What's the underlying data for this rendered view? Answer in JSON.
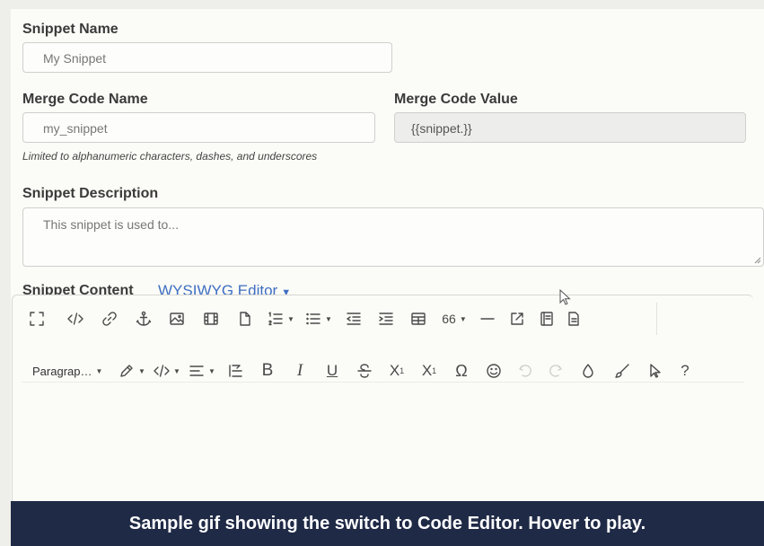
{
  "form": {
    "snippet_name_label": "Snippet Name",
    "snippet_name_value": "My Snippet",
    "merge_code_name_label": "Merge Code Name",
    "merge_code_name_value": "my_snippet",
    "merge_code_value_label": "Merge Code Value",
    "merge_code_value_value": "{{snippet.}}",
    "merge_code_hint": "Limited to alphanumeric characters, dashes, and underscores",
    "description_label": "Snippet Description",
    "description_placeholder": "This snippet is used to...",
    "content_label": "Snippet Content",
    "editor_toggle_label": "WYSIWYG Editor"
  },
  "toolbar": {
    "row1": [
      "fullscreen-icon",
      "code-view-icon",
      "link-icon",
      "anchor-icon",
      "image-icon",
      "video-icon",
      "file-icon",
      "ordered-list-icon",
      "unordered-list-icon",
      "outdent-icon",
      "indent-icon",
      "table-icon",
      "quote-icon",
      "horizontal-rule-icon",
      "external-link-icon",
      "template-icon",
      "document-icon"
    ],
    "quote_label": "66",
    "paragraph_label": "Paragrap…",
    "bold": "B",
    "italic": "I",
    "underline": "U",
    "subscript": "X",
    "subscript_sub": "1",
    "superscript": "X",
    "superscript_sup": "1",
    "omega": "Ω",
    "help": "?"
  },
  "banner": {
    "text": "Sample gif showing the switch to Code Editor. Hover to play."
  },
  "colors": {
    "accent": "#3f6fc2",
    "banner_bg": "#1f2a46"
  }
}
